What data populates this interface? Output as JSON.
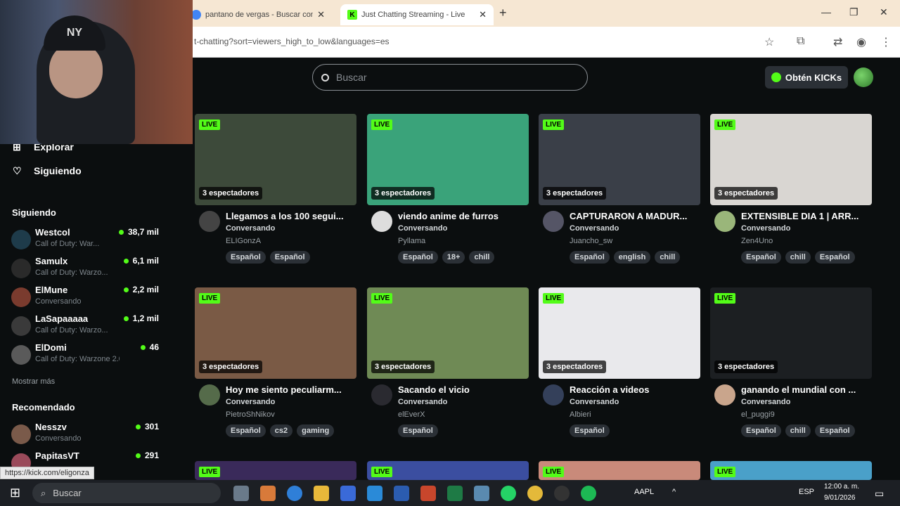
{
  "browser": {
    "tabs": [
      {
        "title": "pantano de vergas - Buscar con",
        "active": false
      },
      {
        "title": "Just Chatting Streaming - Live",
        "active": true
      }
    ],
    "url": "t-chatting?sort=viewers_high_to_low&languages=es"
  },
  "header": {
    "search_placeholder": "Buscar",
    "kicks_label": "Obtén KICKs"
  },
  "sidebar": {
    "nav": [
      {
        "label": "Explorar",
        "icon": "explore-icon"
      },
      {
        "label": "Siguiendo",
        "icon": "heart-icon"
      }
    ],
    "following_heading": "Siguiendo",
    "following": [
      {
        "name": "Westcol",
        "category": "Call of Duty: War...",
        "viewers": "38,7 mil",
        "color": "#1e3b4a"
      },
      {
        "name": "Samulx",
        "category": "Call of Duty: Warzo...",
        "viewers": "6,1 mil",
        "color": "#2a2a2a"
      },
      {
        "name": "ElMune",
        "category": "Conversando",
        "viewers": "2,2 mil",
        "color": "#7a3b2e"
      },
      {
        "name": "LaSapaaaaa",
        "category": "Call of Duty: Warzo...",
        "viewers": "1,2 mil",
        "color": "#3a3a3a"
      },
      {
        "name": "ElDomi",
        "category": "Call of Duty: Warzone 2.0",
        "viewers": "46",
        "color": "#5a5a5a"
      }
    ],
    "show_more": "Mostrar más",
    "recommended_heading": "Recomendado",
    "recommended": [
      {
        "name": "Nesszv",
        "category": "Conversando",
        "viewers": "301",
        "color": "#7a5a4a"
      },
      {
        "name": "PapitasVT",
        "category": "",
        "viewers": "291",
        "color": "#9a4a5a"
      }
    ]
  },
  "status_url": "https://kick.com/eligonza",
  "live_label": "LIVE",
  "streams": [
    {
      "title": "Llegamos a los 100 segui...",
      "category": "Conversando",
      "user": "ELIGonzA",
      "tags": [
        "Español",
        "Español"
      ],
      "viewers": "3 espectadores",
      "thumb": "#3d4a3a",
      "avatar": "#444"
    },
    {
      "title": "viendo anime de furros",
      "category": "Conversando",
      "user": "Pyllama",
      "tags": [
        "Español",
        "18+",
        "chill"
      ],
      "viewers": "3 espectadores",
      "thumb": "#3aa37a",
      "avatar": "#ddd"
    },
    {
      "title": "CAPTURARON A MADUR...",
      "category": "Conversando",
      "user": "Juancho_sw",
      "tags": [
        "Español",
        "english",
        "chill"
      ],
      "viewers": "3 espectadores",
      "thumb": "#3a3f48",
      "avatar": "#556"
    },
    {
      "title": "EXTENSIBLE DIA 1 | ARR...",
      "category": "Conversando",
      "user": "Zen4Uno",
      "tags": [
        "Español",
        "chill",
        "Español"
      ],
      "viewers": "3 espectadores",
      "thumb": "#d9d6d2",
      "avatar": "#9ab67a"
    },
    {
      "title": "Hoy me siento peculiarm...",
      "category": "Conversando",
      "user": "PietroShNikov",
      "tags": [
        "Español",
        "cs2",
        "gaming"
      ],
      "viewers": "3 espectadores",
      "thumb": "#7a5a45",
      "avatar": "#556b4a"
    },
    {
      "title": "Sacando el vicio",
      "category": "Conversando",
      "user": "elEverX",
      "tags": [
        "Español"
      ],
      "viewers": "3 espectadores",
      "thumb": "#6f8a55",
      "avatar": "#2a2a30"
    },
    {
      "title": "Reacción a videos",
      "category": "Conversando",
      "user": "Albieri",
      "tags": [
        "Español"
      ],
      "viewers": "3 espectadores",
      "thumb": "#e9e9ec",
      "avatar": "#34405a"
    },
    {
      "title": "ganando el mundial con ...",
      "category": "Conversando",
      "user": "el_puggi9",
      "tags": [
        "Español",
        "chill",
        "Español"
      ],
      "viewers": "3 espectadores",
      "thumb": "#1c1f22",
      "avatar": "#c9a58c"
    }
  ],
  "next_row_thumbs": [
    "#3a2a5a",
    "#3b4ea0",
    "#c98a7a",
    "#4aa0c9"
  ],
  "taskbar": {
    "search_placeholder": "Buscar",
    "stock": "AAPL",
    "lang": "ESP",
    "time": "12:00 a. m.",
    "date": "9/01/2026"
  }
}
